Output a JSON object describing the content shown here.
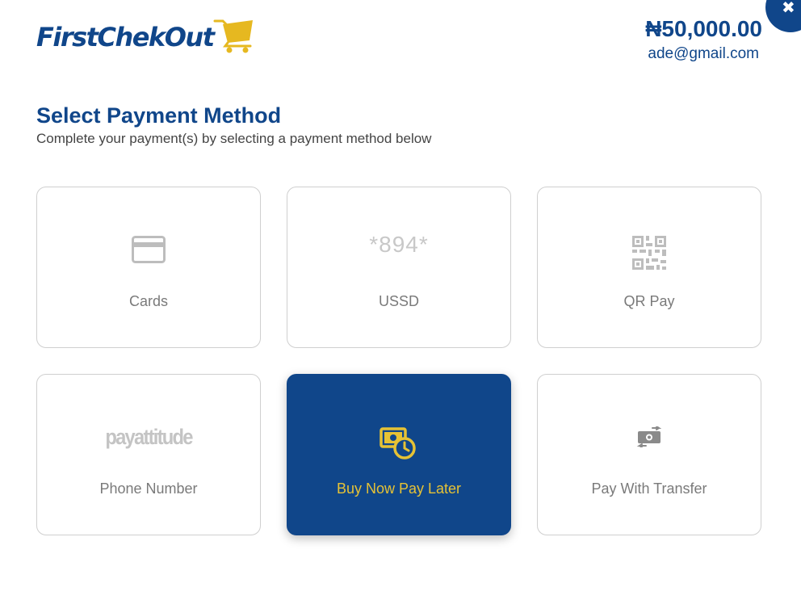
{
  "header": {
    "logo_text": "FirstChekOut",
    "amount": "₦50,000.00",
    "email": "ade@gmail.com",
    "close_label": "✖"
  },
  "main": {
    "title": "Select Payment Method",
    "subtitle": "Complete your payment(s) by selecting a payment method below"
  },
  "methods": [
    {
      "label": "Cards",
      "icon": "credit-card-icon"
    },
    {
      "label": "USSD",
      "icon_text": "*894*",
      "icon": "ussd-code-icon"
    },
    {
      "label": "QR Pay",
      "icon": "qr-code-icon"
    },
    {
      "label": "Phone Number",
      "icon_text": "payattitude",
      "icon": "payattitude-logo"
    },
    {
      "label": "Buy Now Pay Later",
      "icon": "cash-clock-icon",
      "selected": true
    },
    {
      "label": "Pay With Transfer",
      "icon": "money-transfer-icon"
    }
  ],
  "colors": {
    "brand_blue": "#10468a",
    "accent_gold": "#e6c235",
    "icon_gray": "#bdbdbd",
    "label_gray": "#7a7a7a"
  }
}
